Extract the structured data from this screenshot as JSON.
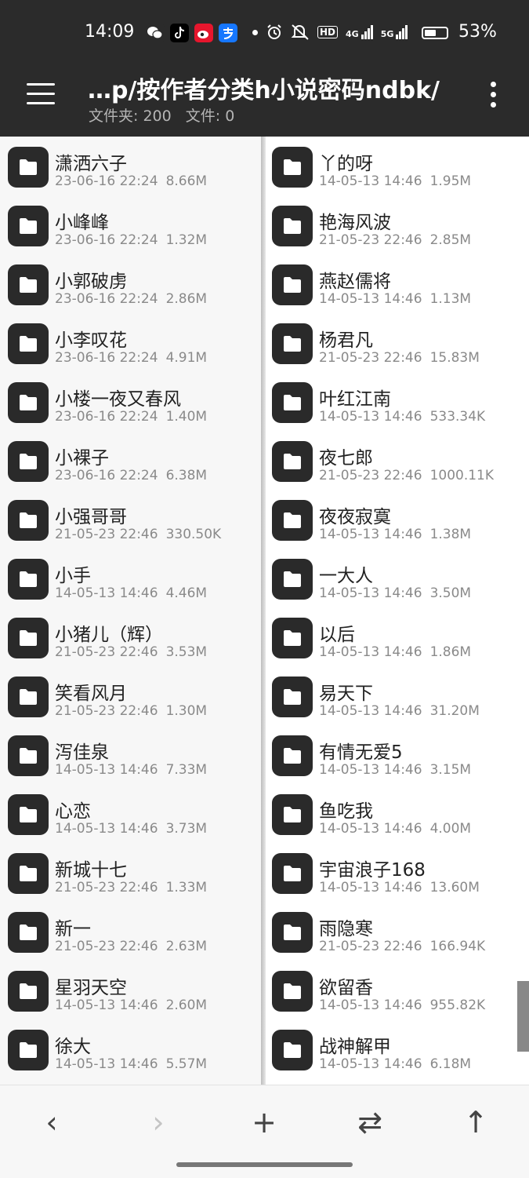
{
  "status": {
    "time": "14:09",
    "battery": "53%",
    "net1": "HD",
    "net2": "4G",
    "net3": "5G"
  },
  "header": {
    "title": "…p/按作者分类h小说密码ndbk/",
    "folders_label": "文件夹: 200",
    "files_label": "文件: 0"
  },
  "left_pane": [
    {
      "name": "潇洒六子",
      "date": "23-06-16 22:24",
      "size": "8.66M"
    },
    {
      "name": "小峰峰",
      "date": "23-06-16 22:24",
      "size": "1.32M"
    },
    {
      "name": "小郭破虏",
      "date": "23-06-16 22:24",
      "size": "2.86M"
    },
    {
      "name": "小李叹花",
      "date": "23-06-16 22:24",
      "size": "4.91M"
    },
    {
      "name": "小楼一夜又春风",
      "date": "23-06-16 22:24",
      "size": "1.40M"
    },
    {
      "name": "小裸子",
      "date": "23-06-16 22:24",
      "size": "6.38M"
    },
    {
      "name": "小强哥哥",
      "date": "21-05-23 22:46",
      "size": "330.50K"
    },
    {
      "name": "小手",
      "date": "14-05-13 14:46",
      "size": "4.46M"
    },
    {
      "name": "小猪儿（辉）",
      "date": "21-05-23 22:46",
      "size": "3.53M"
    },
    {
      "name": "笑看风月",
      "date": "21-05-23 22:46",
      "size": "1.30M"
    },
    {
      "name": "泻佳泉",
      "date": "14-05-13 14:46",
      "size": "7.33M"
    },
    {
      "name": "心恋",
      "date": "14-05-13 14:46",
      "size": "3.73M"
    },
    {
      "name": "新城十七",
      "date": "21-05-23 22:46",
      "size": "1.33M"
    },
    {
      "name": "新一",
      "date": "21-05-23 22:46",
      "size": "2.63M"
    },
    {
      "name": "星羽天空",
      "date": "14-05-13 14:46",
      "size": "2.60M"
    },
    {
      "name": "徐大",
      "date": "14-05-13 14:46",
      "size": "5.57M"
    }
  ],
  "right_pane": [
    {
      "name": "丫的呀",
      "date": "14-05-13 14:46",
      "size": "1.95M"
    },
    {
      "name": "艳海风波",
      "date": "21-05-23 22:46",
      "size": "2.85M"
    },
    {
      "name": "燕赵儒将",
      "date": "14-05-13 14:46",
      "size": "1.13M"
    },
    {
      "name": "杨君凡",
      "date": "21-05-23 22:46",
      "size": "15.83M"
    },
    {
      "name": "叶红江南",
      "date": "14-05-13 14:46",
      "size": "533.34K"
    },
    {
      "name": "夜七郎",
      "date": "21-05-23 22:46",
      "size": "1000.11K"
    },
    {
      "name": "夜夜寂寞",
      "date": "14-05-13 14:46",
      "size": "1.38M"
    },
    {
      "name": "一大人",
      "date": "14-05-13 14:46",
      "size": "3.50M"
    },
    {
      "name": "以后",
      "date": "14-05-13 14:46",
      "size": "1.86M"
    },
    {
      "name": "易天下",
      "date": "14-05-13 14:46",
      "size": "31.20M"
    },
    {
      "name": "有情无爱5",
      "date": "14-05-13 14:46",
      "size": "3.15M"
    },
    {
      "name": "鱼吃我",
      "date": "14-05-13 14:46",
      "size": "4.00M"
    },
    {
      "name": "宇宙浪子168",
      "date": "14-05-13 14:46",
      "size": "13.60M"
    },
    {
      "name": "雨隐寒",
      "date": "21-05-23 22:46",
      "size": "166.94K"
    },
    {
      "name": "欲留香",
      "date": "14-05-13 14:46",
      "size": "955.82K"
    },
    {
      "name": "战神解甲",
      "date": "14-05-13 14:46",
      "size": "6.18M"
    }
  ],
  "bottom": {
    "back": "‹",
    "forward": "›",
    "add": "+",
    "swap": "⇄",
    "up": "↑"
  }
}
